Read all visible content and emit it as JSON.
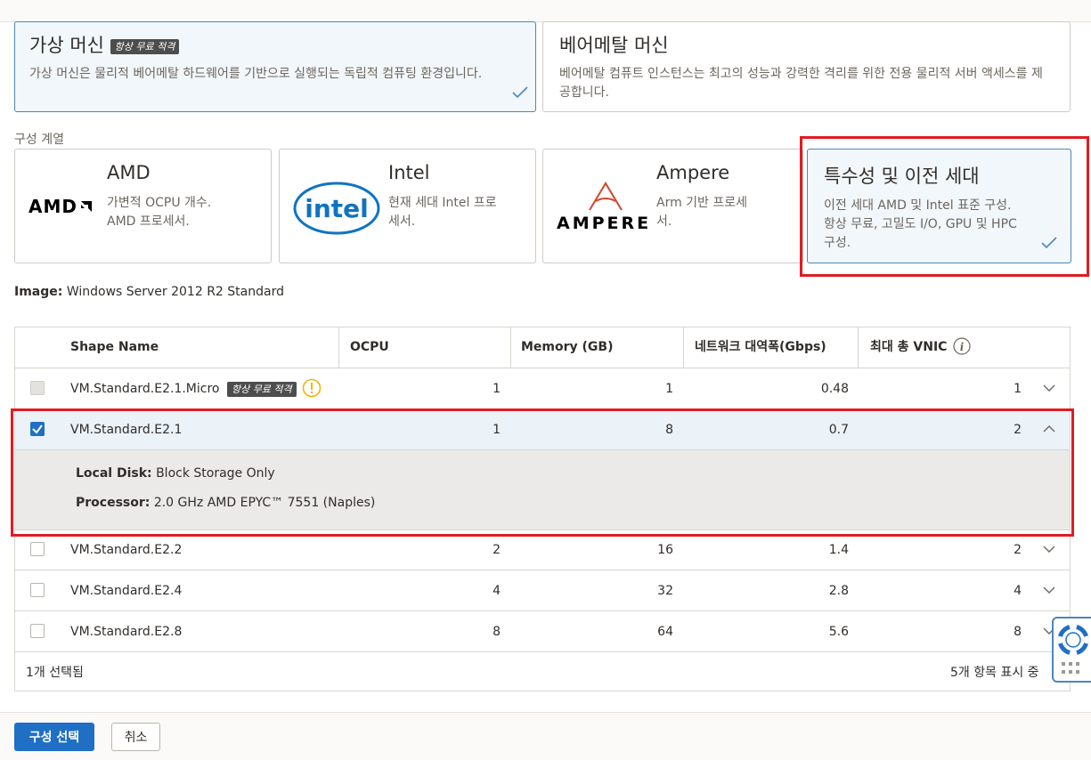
{
  "category_cards": [
    {
      "title": "가상 머신",
      "badge": "항상 무료 적격",
      "description": "가상 머신은 물리적 베어메탈 하드웨어를 기반으로 실행되는 독립적 컴퓨팅 환경입니다."
    },
    {
      "title": "베어메탈 머신",
      "description": "베어메탈 컴퓨트 인스턴스는 최고의 성능과 강력한 격리를 위한 전용 물리적 서버 액세스를 제공합니다."
    }
  ],
  "series_label": "구성 계열",
  "series_cards": [
    {
      "title": "AMD",
      "logo": "AMD",
      "description_lines": [
        "가변적 OCPU 개수.",
        "AMD 프로세서."
      ]
    },
    {
      "title": "Intel",
      "logo": "intel",
      "description_lines": [
        "현재 세대 Intel 프로",
        "세서."
      ]
    },
    {
      "title": "Ampere",
      "logo": "AMPERE",
      "description_lines": [
        "Arm 기반 프로세",
        "서."
      ]
    },
    {
      "title": "특수성 및 이전 세대",
      "description_lines": [
        "이전 세대 AMD 및 Intel 표준 구성.",
        "항상 무료, 고밀도 I/O, GPU 및 HPC",
        "구성."
      ]
    }
  ],
  "image": {
    "label": "Image:",
    "value": "Windows Server 2012 R2 Standard"
  },
  "table": {
    "headers": [
      "Shape Name",
      "OCPU",
      "Memory (GB)",
      "네트워크 대역폭(Gbps)",
      "최대 총 VNIC"
    ],
    "rows": [
      {
        "name": "VM.Standard.E2.1.Micro",
        "badge": "항상 무료 적격",
        "ocpu": "1",
        "memory": "1",
        "bandwidth": "0.48",
        "vnic": "1"
      },
      {
        "name": "VM.Standard.E2.1",
        "ocpu": "1",
        "memory": "8",
        "bandwidth": "0.7",
        "vnic": "2"
      },
      {
        "name": "VM.Standard.E2.2",
        "ocpu": "2",
        "memory": "16",
        "bandwidth": "1.4",
        "vnic": "2"
      },
      {
        "name": "VM.Standard.E2.4",
        "ocpu": "4",
        "memory": "32",
        "bandwidth": "2.8",
        "vnic": "4"
      },
      {
        "name": "VM.Standard.E2.8",
        "ocpu": "8",
        "memory": "64",
        "bandwidth": "5.6",
        "vnic": "8"
      }
    ],
    "details": {
      "local_disk_label": "Local Disk:",
      "local_disk_value": "Block Storage Only",
      "processor_label": "Processor:",
      "processor_value": "2.0 GHz AMD EPYC™ 7551 (Naples)"
    },
    "footer_selected": "1개 선택됨",
    "footer_showing": "5개 항목 표시 중"
  },
  "buttons": {
    "select": "구성 선택",
    "cancel": "취소"
  },
  "colors": {
    "accent": "#1f6fc4",
    "highlight": "#e11b22",
    "selected_card": "#f2f7fb"
  },
  "icons": [
    "check-icon",
    "info-icon",
    "warning-icon",
    "chevron-down-icon",
    "chevron-up-icon",
    "lifebuoy-icon",
    "grid-icon"
  ]
}
